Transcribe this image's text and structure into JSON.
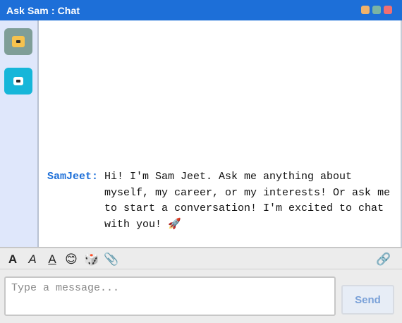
{
  "window": {
    "title": "Ask Sam : Chat",
    "colors": {
      "titlebar": "#1d6fd8",
      "sidebar": "#dfe7fb",
      "author": "#1d6fd8"
    }
  },
  "sidebar": {
    "contacts": [
      {
        "icon": "robot-face-icon",
        "color": "#7f9e98"
      },
      {
        "icon": "chat-bubble-icon",
        "color": "#16b6d9"
      }
    ]
  },
  "chat": {
    "messages": [
      {
        "author": "SamJeet:",
        "text": "Hi! I'm Sam Jeet. Ask me anything about\nmyself, my career, or my interests! Or ask me\nto start a conversation! I'm excited to chat\nwith you! 🚀"
      }
    ]
  },
  "toolbar": {
    "bold": "A",
    "italic": "A",
    "underline": "A",
    "emoji": "😊",
    "dice": "🎲",
    "attach": "📎",
    "link": "🔗"
  },
  "compose": {
    "placeholder": "Type a message...",
    "value": "",
    "send_label": "Send"
  }
}
